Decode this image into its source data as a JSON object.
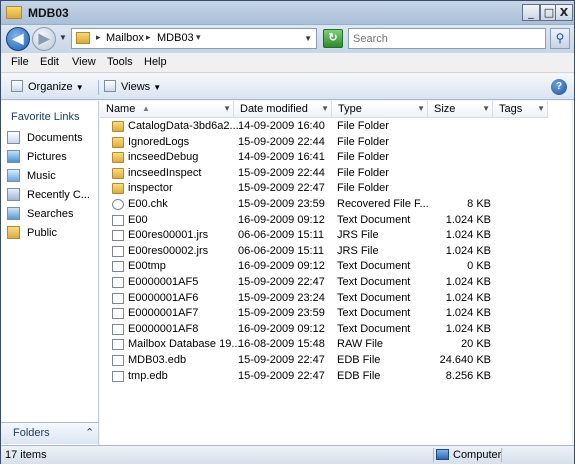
{
  "window": {
    "title": "MDB03",
    "min_glyph": "_",
    "max_glyph": "□",
    "close_glyph": "X"
  },
  "address": {
    "crumbs": [
      "Mailbox",
      "MDB03"
    ],
    "search_placeholder": "Search"
  },
  "menu": [
    "File",
    "Edit",
    "View",
    "Tools",
    "Help"
  ],
  "toolbar": {
    "organize_label": "Organize",
    "views_label": "Views"
  },
  "nav": {
    "header": "Favorite Links",
    "items": [
      {
        "label": "Documents",
        "icon": "documents-icon"
      },
      {
        "label": "Pictures",
        "icon": "pictures-icon"
      },
      {
        "label": "Music",
        "icon": "music-icon"
      },
      {
        "label": "Recently C...",
        "icon": "recent-icon"
      },
      {
        "label": "Searches",
        "icon": "searches-icon"
      },
      {
        "label": "Public",
        "icon": "public-folder-icon"
      }
    ],
    "folders_label": "Folders"
  },
  "columns": [
    "Name",
    "Date modified",
    "Type",
    "Size",
    "Tags"
  ],
  "files": [
    {
      "name": "CatalogData-3bd6a2...",
      "date": "14-09-2009 16:40",
      "type": "File Folder",
      "size": "",
      "icon": "folder"
    },
    {
      "name": "IgnoredLogs",
      "date": "15-09-2009 22:44",
      "type": "File Folder",
      "size": "",
      "icon": "folder"
    },
    {
      "name": "incseedDebug",
      "date": "14-09-2009 16:41",
      "type": "File Folder",
      "size": "",
      "icon": "folder"
    },
    {
      "name": "incseedInspect",
      "date": "15-09-2009 22:44",
      "type": "File Folder",
      "size": "",
      "icon": "folder"
    },
    {
      "name": "inspector",
      "date": "15-09-2009 22:47",
      "type": "File Folder",
      "size": "",
      "icon": "folder"
    },
    {
      "name": "E00.chk",
      "date": "15-09-2009 23:59",
      "type": "Recovered File F...",
      "size": "8 KB",
      "icon": "chk"
    },
    {
      "name": "E00",
      "date": "16-09-2009 09:12",
      "type": "Text Document",
      "size": "1.024 KB",
      "icon": "doc"
    },
    {
      "name": "E00res00001.jrs",
      "date": "06-06-2009 15:11",
      "type": "JRS File",
      "size": "1.024 KB",
      "icon": "doc"
    },
    {
      "name": "E00res00002.jrs",
      "date": "06-06-2009 15:11",
      "type": "JRS File",
      "size": "1.024 KB",
      "icon": "doc"
    },
    {
      "name": "E00tmp",
      "date": "16-09-2009 09:12",
      "type": "Text Document",
      "size": "0 KB",
      "icon": "doc"
    },
    {
      "name": "E0000001AF5",
      "date": "15-09-2009 22:47",
      "type": "Text Document",
      "size": "1.024 KB",
      "icon": "doc"
    },
    {
      "name": "E0000001AF6",
      "date": "15-09-2009 23:24",
      "type": "Text Document",
      "size": "1.024 KB",
      "icon": "doc"
    },
    {
      "name": "E0000001AF7",
      "date": "15-09-2009 23:59",
      "type": "Text Document",
      "size": "1.024 KB",
      "icon": "doc"
    },
    {
      "name": "E0000001AF8",
      "date": "16-09-2009 09:12",
      "type": "Text Document",
      "size": "1.024 KB",
      "icon": "doc"
    },
    {
      "name": "Mailbox Database 19...",
      "date": "16-08-2009 15:48",
      "type": "RAW File",
      "size": "20 KB",
      "icon": "doc"
    },
    {
      "name": "MDB03.edb",
      "date": "15-09-2009 22:47",
      "type": "EDB File",
      "size": "24.640 KB",
      "icon": "doc"
    },
    {
      "name": "tmp.edb",
      "date": "15-09-2009 22:47",
      "type": "EDB File",
      "size": "8.256 KB",
      "icon": "doc"
    }
  ],
  "status": {
    "items_text": "17 items",
    "location": "Computer"
  },
  "colors": {
    "accent": "#1d5fb0",
    "folder": "#dbac3f"
  }
}
